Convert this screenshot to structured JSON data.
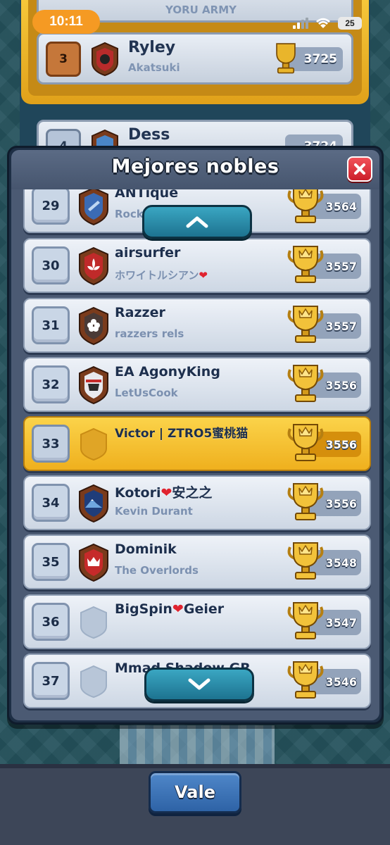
{
  "status_bar": {
    "time": "10:11",
    "battery": "25"
  },
  "background": {
    "top_clan": "YORU ARMY",
    "rows": [
      {
        "rank": "3",
        "name": "Ryley",
        "clan": "Akatsuki",
        "trophies": "3725"
      },
      {
        "rank": "4",
        "name": "Dess",
        "trophies": "3724"
      }
    ]
  },
  "modal": {
    "title": "Mejores nobles",
    "rows": [
      {
        "rank": "29",
        "name": "ANTique",
        "clan": "Rock",
        "trophies": "3564"
      },
      {
        "rank": "30",
        "name": "airsurfer",
        "clan": "ホワイトルシアン",
        "trophies": "3557"
      },
      {
        "rank": "31",
        "name": "Razzer",
        "clan": "razzers rels",
        "trophies": "3557"
      },
      {
        "rank": "32",
        "name": "EA AgonyKing",
        "clan": "LetUsCook",
        "trophies": "3556"
      },
      {
        "rank": "33",
        "name": "Victor | ZTRO5蜜桃猫",
        "clan": "",
        "trophies": "3556"
      },
      {
        "rank": "34",
        "name": "Kotori",
        "name_suffix": "安之之",
        "clan": "Kevin Durant",
        "trophies": "3556"
      },
      {
        "rank": "35",
        "name": "Dominik",
        "clan": "The Overlords",
        "trophies": "3548"
      },
      {
        "rank": "36",
        "name": "BigSpin",
        "name_suffix": "Geier",
        "clan": "",
        "trophies": "3547"
      },
      {
        "rank": "37",
        "name": "Mmad Shadow GR",
        "clan": "",
        "trophies": "3546"
      }
    ]
  },
  "footer": {
    "ok_label": "Vale"
  }
}
